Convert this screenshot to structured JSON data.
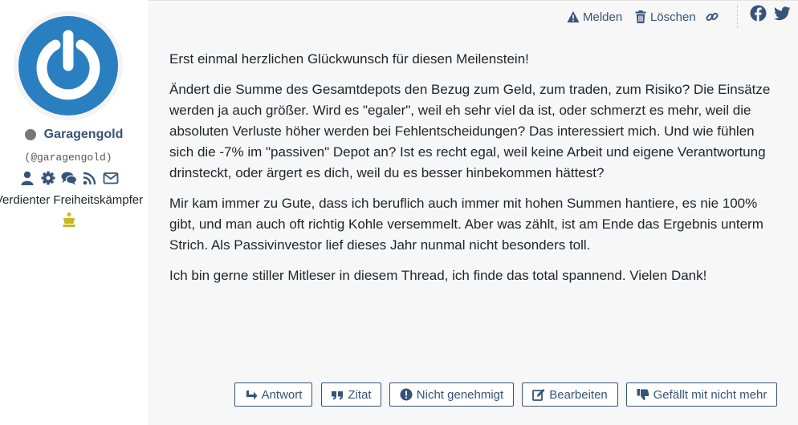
{
  "author": {
    "username": "Garagengold",
    "handle": "(@garagengold)",
    "rank": "Verdienter Freiheitskämpfer",
    "status": "offline",
    "avatar_icon": "power-icon",
    "profile_icons": [
      "user-icon",
      "gear-icon",
      "comments-icon",
      "rss-icon",
      "envelope-icon"
    ],
    "rank_icon": "crown-icon",
    "colors": {
      "avatar_blue": "#2a7fc1",
      "name": "#36537a",
      "crown": "#c9b81e"
    }
  },
  "post_tools": {
    "report_label": "Melden",
    "delete_label": "Löschen",
    "link_icon": "link-icon",
    "share": [
      "facebook-icon",
      "twitter-icon"
    ]
  },
  "post": {
    "paragraphs": [
      "Erst einmal herzlichen Glückwunsch für diesen Meilenstein!",
      "Ändert die Summe des Gesamtdepots den Bezug zum Geld, zum traden,  zum Risiko? Die Einsätze werden ja auch größer. Wird es \"egaler\", weil eh sehr viel da ist, oder schmerzt es mehr, weil die absoluten Verluste höher werden bei Fehlentscheidungen? Das interessiert mich. Und wie fühlen sich die -7% im \"passiven\" Depot an? Ist es recht egal, weil keine Arbeit und eigene Verantwortung drinsteckt, oder ärgert es dich, weil du es besser hinbekommen hättest?",
      "Mir kam immer zu Gute, dass ich beruflich auch immer mit hohen Summen hantiere, es nie 100% gibt, und man auch oft richtig Kohle versemmelt. Aber was zählt, ist am Ende das Ergebnis unterm Strich. Als Passivinvestor lief dieses Jahr nunmal nicht besonders toll.",
      "Ich bin gerne stiller Mitleser in diesem Thread, ich finde das total spannend. Vielen Dank!"
    ]
  },
  "actions": {
    "reply_label": "Antwort",
    "quote_label": "Zitat",
    "unapproved_label": "Nicht genehmigt",
    "edit_label": "Bearbeiten",
    "unlike_label": "Gefällt mit nicht mehr"
  }
}
